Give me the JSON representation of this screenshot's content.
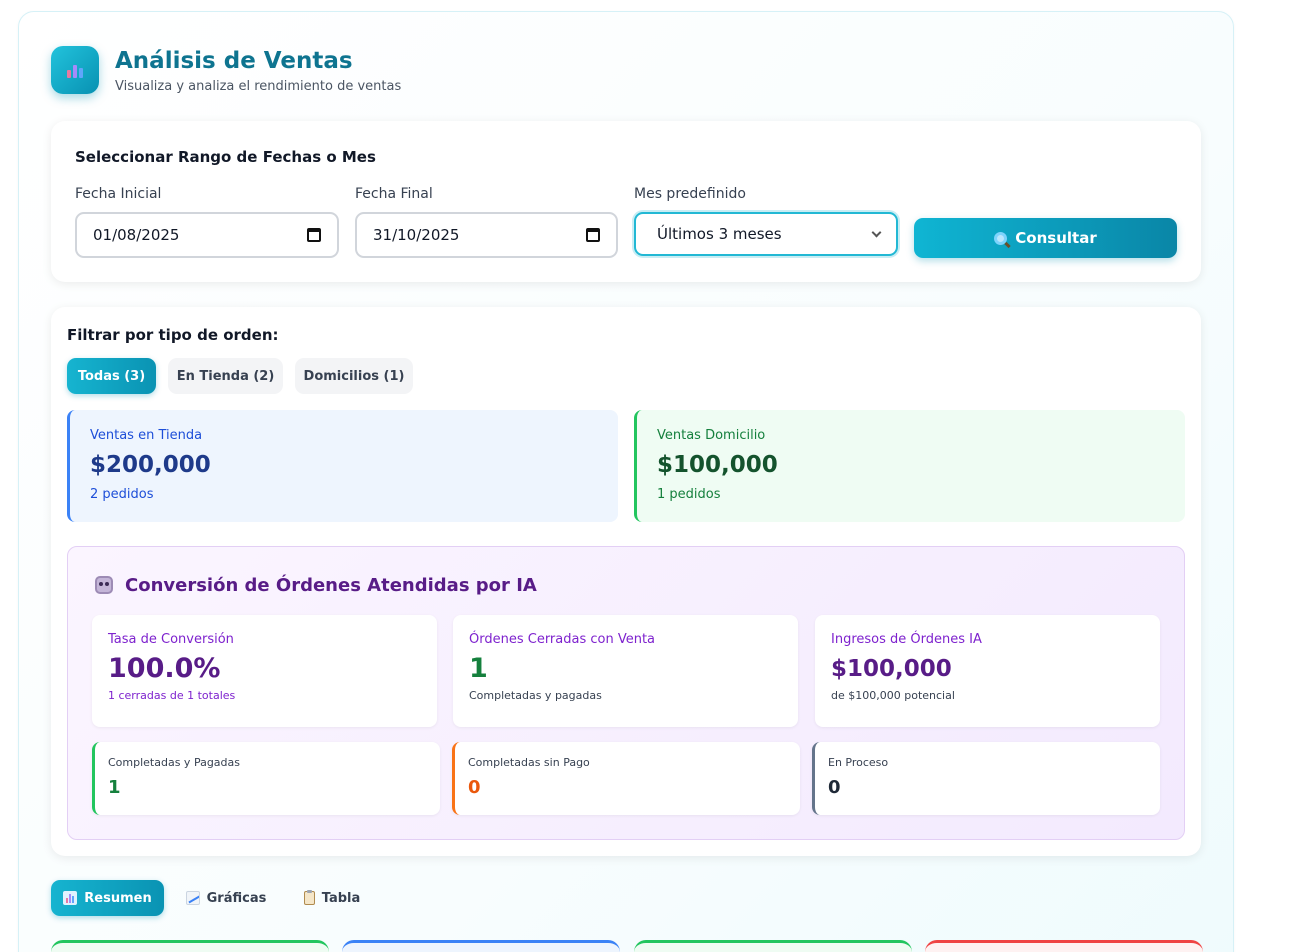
{
  "header": {
    "title": "Análisis de Ventas",
    "subtitle": "Visualiza y analiza el rendimiento de ventas",
    "logo_icon": "bar-chart-icon"
  },
  "date_range": {
    "section_title": "Seleccionar Rango de Fechas o Mes",
    "start_label": "Fecha Inicial",
    "start_value": "01/08/2025",
    "end_label": "Fecha Final",
    "end_value": "31/10/2025",
    "preset_label": "Mes predefinido",
    "preset_value": "Últimos 3 meses",
    "consult_label": "Consultar",
    "consult_icon": "magnifier-icon"
  },
  "filter": {
    "title": "Filtrar por tipo de orden:",
    "options": [
      {
        "label": "Todas (3)",
        "active": true
      },
      {
        "label": "En Tienda (2)",
        "active": false
      },
      {
        "label": "Domicilios (1)",
        "active": false
      }
    ]
  },
  "sales": {
    "store": {
      "label": "Ventas en Tienda",
      "value": "$200,000",
      "sub": "2 pedidos",
      "color": "#3b82f6"
    },
    "delivery": {
      "label": "Ventas Domicilio",
      "value": "$100,000",
      "sub": "1 pedidos",
      "color": "#22c55e"
    }
  },
  "ia": {
    "title": "Conversión de Órdenes Atendidas por IA",
    "icon": "robot-icon",
    "cards": [
      {
        "label": "Tasa de Conversión",
        "value": "100.0%",
        "sub": "1 cerradas de 1 totales"
      },
      {
        "label": "Órdenes Cerradas con Venta",
        "value": "1",
        "sub": "Completadas y pagadas"
      },
      {
        "label": "Ingresos de Órdenes IA",
        "value": "$100,000",
        "sub": "de $100,000 potencial"
      }
    ],
    "status": [
      {
        "label": "Completadas y Pagadas",
        "value": "1",
        "color": "#22c55e"
      },
      {
        "label": "Completadas sin Pago",
        "value": "0",
        "color": "#f97316"
      },
      {
        "label": "En Proceso",
        "value": "0",
        "color": "#64748b"
      }
    ]
  },
  "tabs": [
    {
      "label": "Resumen",
      "icon": "bar-chart-icon",
      "active": true
    },
    {
      "label": "Gráficas",
      "icon": "line-chart-icon",
      "active": false
    },
    {
      "label": "Tabla",
      "icon": "clipboard-icon",
      "active": false
    }
  ],
  "colors": {
    "accent": "#0891b2",
    "ia_purple": "#581c87"
  }
}
